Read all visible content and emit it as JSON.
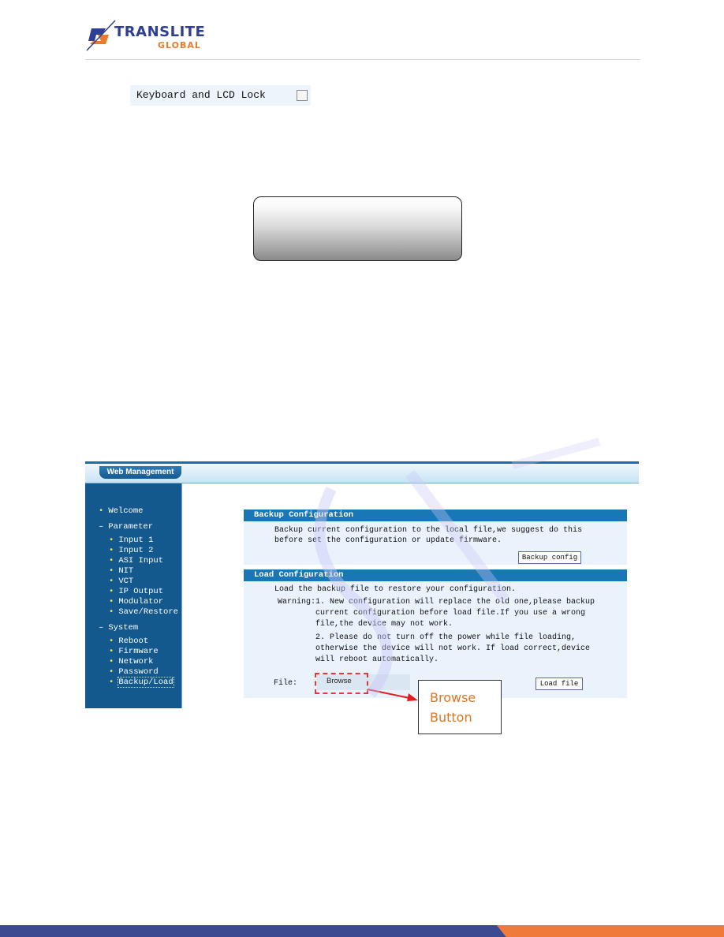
{
  "brand": {
    "name_main": "TRANSLITE",
    "name_sub": "GLOBAL",
    "colors": {
      "blue": "#2e3f94",
      "orange": "#e97b2e"
    }
  },
  "keyboard_lock": {
    "label": "Keyboard and LCD Lock",
    "checked": false
  },
  "lcd_panel": {
    "text": ""
  },
  "web_ui": {
    "tab_label": "Web Management",
    "sidebar": [
      {
        "type": "item",
        "label": "Welcome",
        "indent": 0
      },
      {
        "type": "group",
        "label": "Parameter",
        "indent": 0
      },
      {
        "type": "item",
        "label": "Input 1",
        "indent": 1
      },
      {
        "type": "item",
        "label": "Input 2",
        "indent": 1
      },
      {
        "type": "item",
        "label": "ASI Input",
        "indent": 1
      },
      {
        "type": "item",
        "label": "NIT",
        "indent": 1
      },
      {
        "type": "item",
        "label": "VCT",
        "indent": 1
      },
      {
        "type": "item",
        "label": "IP Output",
        "indent": 1
      },
      {
        "type": "item",
        "label": "Modulator",
        "indent": 1
      },
      {
        "type": "item",
        "label": "Save/Restore",
        "indent": 1
      },
      {
        "type": "group",
        "label": "System",
        "indent": 0
      },
      {
        "type": "item",
        "label": "Reboot",
        "indent": 1
      },
      {
        "type": "item",
        "label": "Firmware",
        "indent": 1
      },
      {
        "type": "item",
        "label": "Network",
        "indent": 1
      },
      {
        "type": "item",
        "label": "Password",
        "indent": 1
      },
      {
        "type": "item",
        "label": "Backup/Load",
        "indent": 1,
        "selected": true
      }
    ],
    "backup": {
      "title": "Backup Configuration",
      "description_line1": "Backup current configuration to the local file,we suggest do this",
      "description_line2": "before set the configuration or update firmware.",
      "button_label": "Backup config"
    },
    "load": {
      "title": "Load Configuration",
      "description": "Load the backup file to restore your configuration.",
      "warning_label": "Warning:",
      "warning1_line1": "1. New configuration will replace the old one,please backup",
      "warning1_line2": "current configuration before load file.If you use a wrong",
      "warning1_line3": "file,the device may not work.",
      "warning2_line1": "2. Please do not turn off the power while file loading,",
      "warning2_line2": "otherwise the device will not work. If load correct,device",
      "warning2_line3": "will reboot automatically.",
      "file_label": "File:",
      "browse_label": "Browse",
      "button_label": "Load file"
    }
  },
  "callout": {
    "line1": "Browse",
    "line2": "Button"
  },
  "footer": {
    "colors": {
      "left": "#3d4991",
      "right": "#ef7a3a"
    }
  }
}
